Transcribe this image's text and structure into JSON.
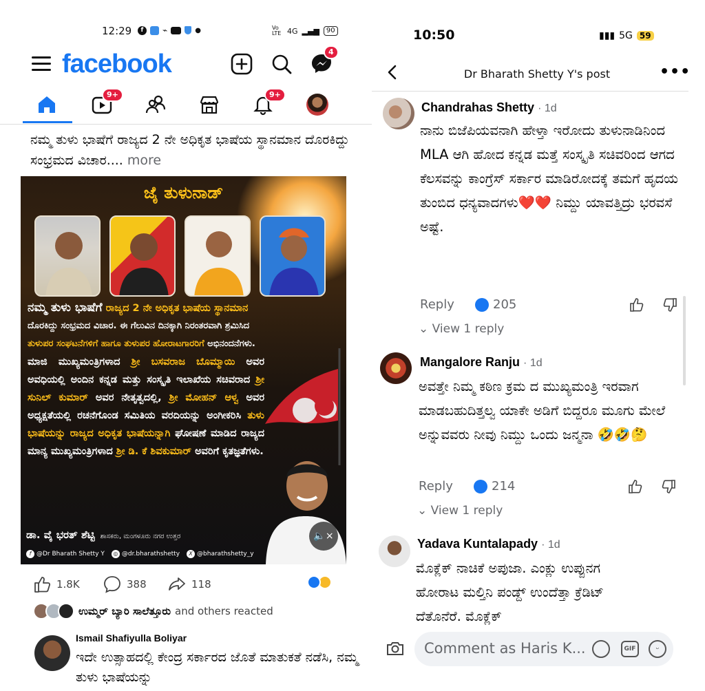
{
  "left": {
    "status": {
      "time": "12:29",
      "net": "Vo LTE",
      "signal": "4G",
      "battery": "90"
    },
    "header": {
      "logo": "facebook",
      "messenger_badge": "4"
    },
    "nav": {
      "video_badge": "9+",
      "notif_badge": "9+"
    },
    "post": {
      "text": "ನಮ್ಮ ತುಳು ಭಾಷೆಗೆ ರಾಜ್ಯದ 2 ನೇ ಅಧಿಕೃತ ಭಾಷೆಯ ಸ್ಥಾನಮಾನ ದೊರಕಿದ್ದು ಸಂಭ್ರಮದ ವಿಚಾರ....",
      "more": "more",
      "poster": {
        "title": "ಜೈ ತುಳುನಾಡ್",
        "line1a": "ನಮ್ಮ ತುಳು ಭಾಷೆಗೆ",
        "line1b": " ರಾಜ್ಯದ 2 ನೇ ಅಧಿಕೃತ ಭಾಷೆಯ ಸ್ಥಾನಮಾನ",
        "line2": "ದೊರಕಿದ್ದು ಸಂಭ್ರಮದ ವಿಚಾರ. ಈ ಗೆಲುವಿನ ದಿನಕ್ಕಾಗಿ ನಿರಂತರವಾಗಿ ಶ್ರಮಿಸಿದ",
        "line3a": "ತುಳುಪರ ಸಂಘಟನೆಗಳಿಗೆ ಹಾಗೂ ತುಳುಪರ ಹೋರಾಟಗಾರರಿಗೆ",
        "line3b": " ಅಭಿನಂದನೆಗಳು.",
        "para_a": "ಮಾಜಿ ಮುಖ್ಯಮಂತ್ರಿಗಳಾದ ",
        "para_b": "ಶ್ರೀ ಬಸವರಾಜ ಬೊಮ್ಮಾಯಿ",
        "para_c": " ಅವರ ಅವಧಿಯಲ್ಲಿ ಅಂದಿನ ಕನ್ನಡ ಮತ್ತು ಸಂಸ್ಕೃತಿ ಇಲಾಖೆಯ ಸಚಿವರಾದ ",
        "para_d": "ಶ್ರೀ ಸುನಿಲ್ ಕುಮಾರ್",
        "para_e": " ಅವರ ನೇತೃತ್ವದಲ್ಲಿ, ",
        "para_f": "ಶ್ರೀ ಮೋಹನ್ ಆಳ್ವ",
        "para_g": " ಅವರ ಅಧ್ಯಕ್ಷತೆಯಲ್ಲಿ ರಚನೆಗೊಂಡ ಸಮಿತಿಯ ವರದಿಯನ್ನು ಅಂಗೀಕರಿಸಿ ",
        "para_h": "ತುಳು ಭಾಷೆಯನ್ನು ರಾಜ್ಯದ ಅಧಿಕೃತ ಭಾಷೆಯನ್ನಾಗಿ",
        "para_i": " ಘೋಷಣೆ ಮಾಡಿದ ರಾಜ್ಯದ ಮಾನ್ಯ ಮುಖ್ಯಮಂತ್ರಿಗಳಾದ ",
        "para_j": "ಶ್ರೀ ಡಿ. ಕೆ ಶಿವಕುಮಾರ್",
        "para_k": " ಅವರಿಗೆ ಕೃತಜ್ಞತೆಗಳು.",
        "sign_name": "ಡಾ. ವೈ ಭರತ್ ಶೆಟ್ಟಿ",
        "sign_role": "ಶಾಸಕರು, ಮಂಗಳೂರು ನಗರ ಉತ್ತರ",
        "fb_handle": "@Dr Bharath Shetty Y",
        "ig_handle": "@dr.bharathshetty",
        "x_handle": "@bharathshetty_y"
      }
    },
    "actions": {
      "likes": "1.8K",
      "comments": "388",
      "shares": "118"
    },
    "reacted": {
      "names": "ಉಮ್ಮರ್ ಬ್ಯಾರಿ ಸಾಲೆತ್ತೂರು",
      "rest": "and others reacted"
    },
    "comment": {
      "name": "Ismail Shafiyulla Boliyar",
      "text": "ಇದೇ ಉತ್ಸಾಹದಲ್ಲಿ ಕೇಂದ್ರ ಸರ್ಕಾರದ ಜೊತೆ ಮಾತುಕತೆ ನಡೆಸಿ, ನಮ್ಮ ತುಳು ಭಾಷೆಯನ್ನು"
    }
  },
  "right": {
    "status": {
      "time": "10:50",
      "network": "5G",
      "battery": "59"
    },
    "header": {
      "title": "Dr Bharath Shetty Y's post"
    },
    "comments": [
      {
        "name": "Chandrahas Shetty",
        "time": "· 1d",
        "text": "ನಾನು ಬಿಜೆಪಿಯವನಾಗಿ ಹೇಳ್ತಾ ಇರೋದು ತುಳುನಾಡಿನಿಂದ MLA ಆಗಿ ಹೋದ ಕನ್ನಡ ಮತ್ತೆ ಸಂಸ್ಕೃತಿ ಸಚಿವರಿಂದ ಆಗದ ಕೆಲಸವನ್ನು ಕಾಂಗ್ರೆಸ್ ಸರ್ಕಾರ ಮಾಡಿರೋದಕ್ಕೆ ತಮಗೆ ಹೃದಯ ತುಂಬಿದ ಧನ್ಯವಾದಗಳು❤️❤️ ನಿಮ್ದು ಯಾವತ್ತಿದ್ರು ಭರವಸೆ ಅಷ್ಟೆ.",
        "reply": "Reply",
        "likes": "205",
        "view": "View 1 reply"
      },
      {
        "name": "Mangalore Ranju",
        "time": "· 1d",
        "text": "ಅವತ್ತೇ ನಿಮ್ಮ ಕಠಿಣ ಕ್ರಮ ದ ಮುಖ್ಯಮಂತ್ರಿ ಇರವಾಗ ಮಾಡಬಹುದಿತ್ತಲ್ವ ಯಾಕೇ ಅಡಿಗೆ ಬಿದ್ದರೂ ಮೂಗು ಮೇಲೆ ಅನ್ನುವವರು ನೀವು ನಿಮ್ದು ಒಂದು ಜನ್ಮನಾ 🤣🤣🤔",
        "reply": "Reply",
        "likes": "214",
        "view": "View 1 reply"
      },
      {
        "name": "Yadava Kuntalapady",
        "time": "· 1d",
        "text": "ಮೊಕ್ಲೆಕ್ ನಾಚಿಕೆ ಅಪುಜಾ. ಎಂಕ್ಲು ಉಪ್ಪುನಗ ಹೋರಾಟ ಮಲ್ತಿನಿ ಪಂಡ್ದ್ ಉಂದೆತ್ತಾ ಕ್ರೆಡಿಟ್ ದೆತೊನೆರೆ. ಮೊಕ್ಲೆಕ್"
      }
    ],
    "composer": {
      "placeholder": "Comment as Haris K..."
    }
  }
}
